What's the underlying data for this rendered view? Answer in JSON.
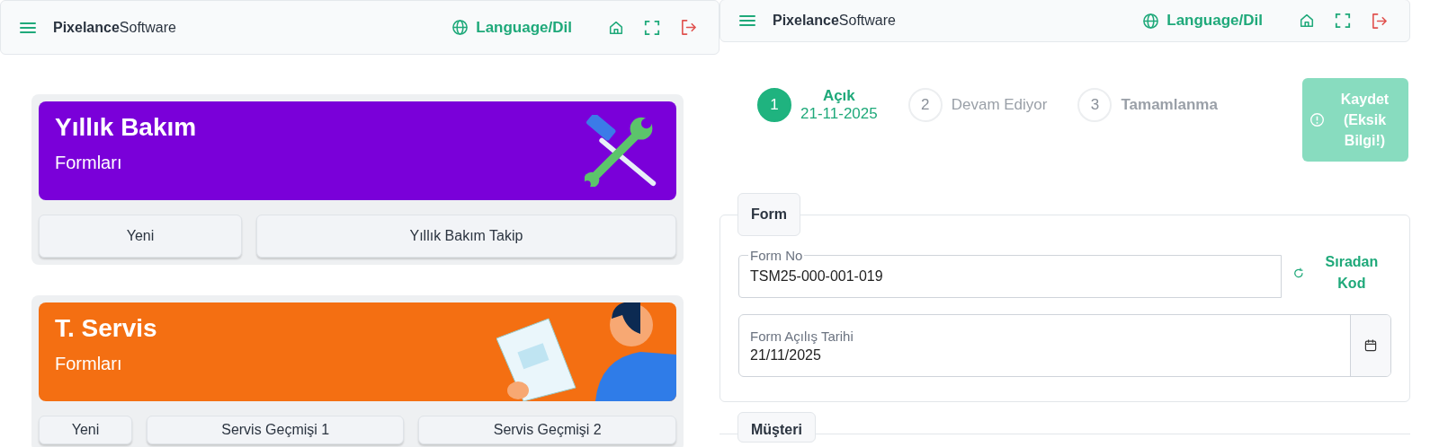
{
  "left_pane": {
    "header": {
      "brand": "**Pixelance**Software",
      "language": "Language/Dil"
    },
    "cards": [
      {
        "title": "Yıllık Bakım",
        "subtitle": "Formları",
        "color": "#7a00d9",
        "kind": "tools",
        "buttons": [
          "Yeni",
          "Yıllık Bakım Takip"
        ]
      },
      {
        "title": "T. Servis",
        "subtitle": "Formları",
        "color": "#f46f12",
        "kind": "reader",
        "buttons": [
          "Yeni",
          "Servis Geçmişi 1",
          "Servis Geçmişi 2"
        ]
      }
    ]
  },
  "right_pane": {
    "header": {
      "brand": "**Pixelance**Software",
      "language": "Language/Dil"
    },
    "steps": [
      {
        "number": "1",
        "label": "Açık",
        "date": "21-11-2025",
        "selected": true,
        "emphasized": true
      },
      {
        "number": "2",
        "label": "Devam Ediyor",
        "selected": false,
        "emphasized": false
      },
      {
        "number": "3",
        "label": "Tamamlanma",
        "selected": false,
        "emphasized": true
      }
    ],
    "save_button": {
      "label": "Kaydet (Eksik Bilgi!)",
      "disabled": true
    },
    "sections": [
      {
        "legend": "Form",
        "fields": [
          {
            "kind": "text",
            "label": "Form No",
            "value": "TSM25-000-001-019",
            "action": "Sıradan Kod"
          },
          {
            "kind": "date",
            "label": "Form Açılış Tarihi",
            "value": "21/11/2025"
          }
        ]
      },
      {
        "legend": "Müşteri"
      }
    ]
  }
}
